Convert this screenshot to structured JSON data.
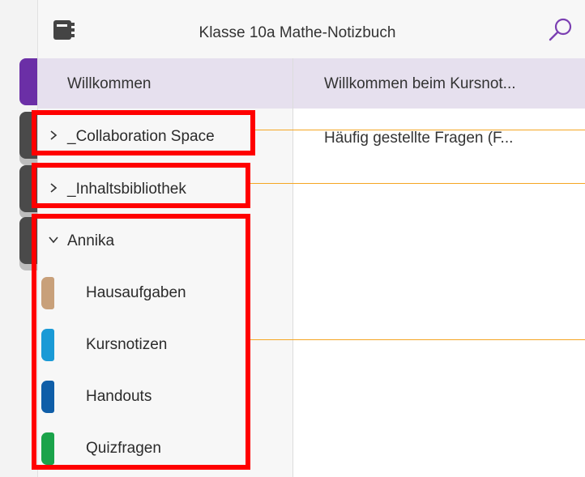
{
  "header": {
    "title": "Klasse 10a Mathe-Notizbuch",
    "notebook_icon": "notebook-icon",
    "search_icon": "search-icon"
  },
  "section_header": "Willkommen",
  "page_header": "Willkommen beim Kursnot...",
  "section_groups": [
    {
      "label": "_Collaboration Space",
      "expanded": false
    },
    {
      "label": "_Inhaltsbibliothek",
      "expanded": false
    },
    {
      "label": "Annika",
      "expanded": true
    }
  ],
  "annika_sections": [
    {
      "label": "Hausaufgaben",
      "color": "#c8a07a"
    },
    {
      "label": "Kursnotizen",
      "color": "#1a9ad6"
    },
    {
      "label": "Handouts",
      "color": "#0f5ea8"
    },
    {
      "label": "Quizfragen",
      "color": "#1aa34a"
    }
  ],
  "pages": [
    {
      "label": "Häufig gestellte Fragen (F..."
    }
  ],
  "colors": {
    "header_band": "#e6e0ee",
    "accent_purple": "#7b3fb2",
    "highlight_red": "#ff0000",
    "callout_orange": "#f5a623"
  },
  "notebook_tabs": [
    {
      "color": "#6b2fa6"
    },
    {
      "color": "#4a4a4a"
    },
    {
      "color": "#4a4a4a"
    },
    {
      "color": "#4a4a4a"
    }
  ]
}
